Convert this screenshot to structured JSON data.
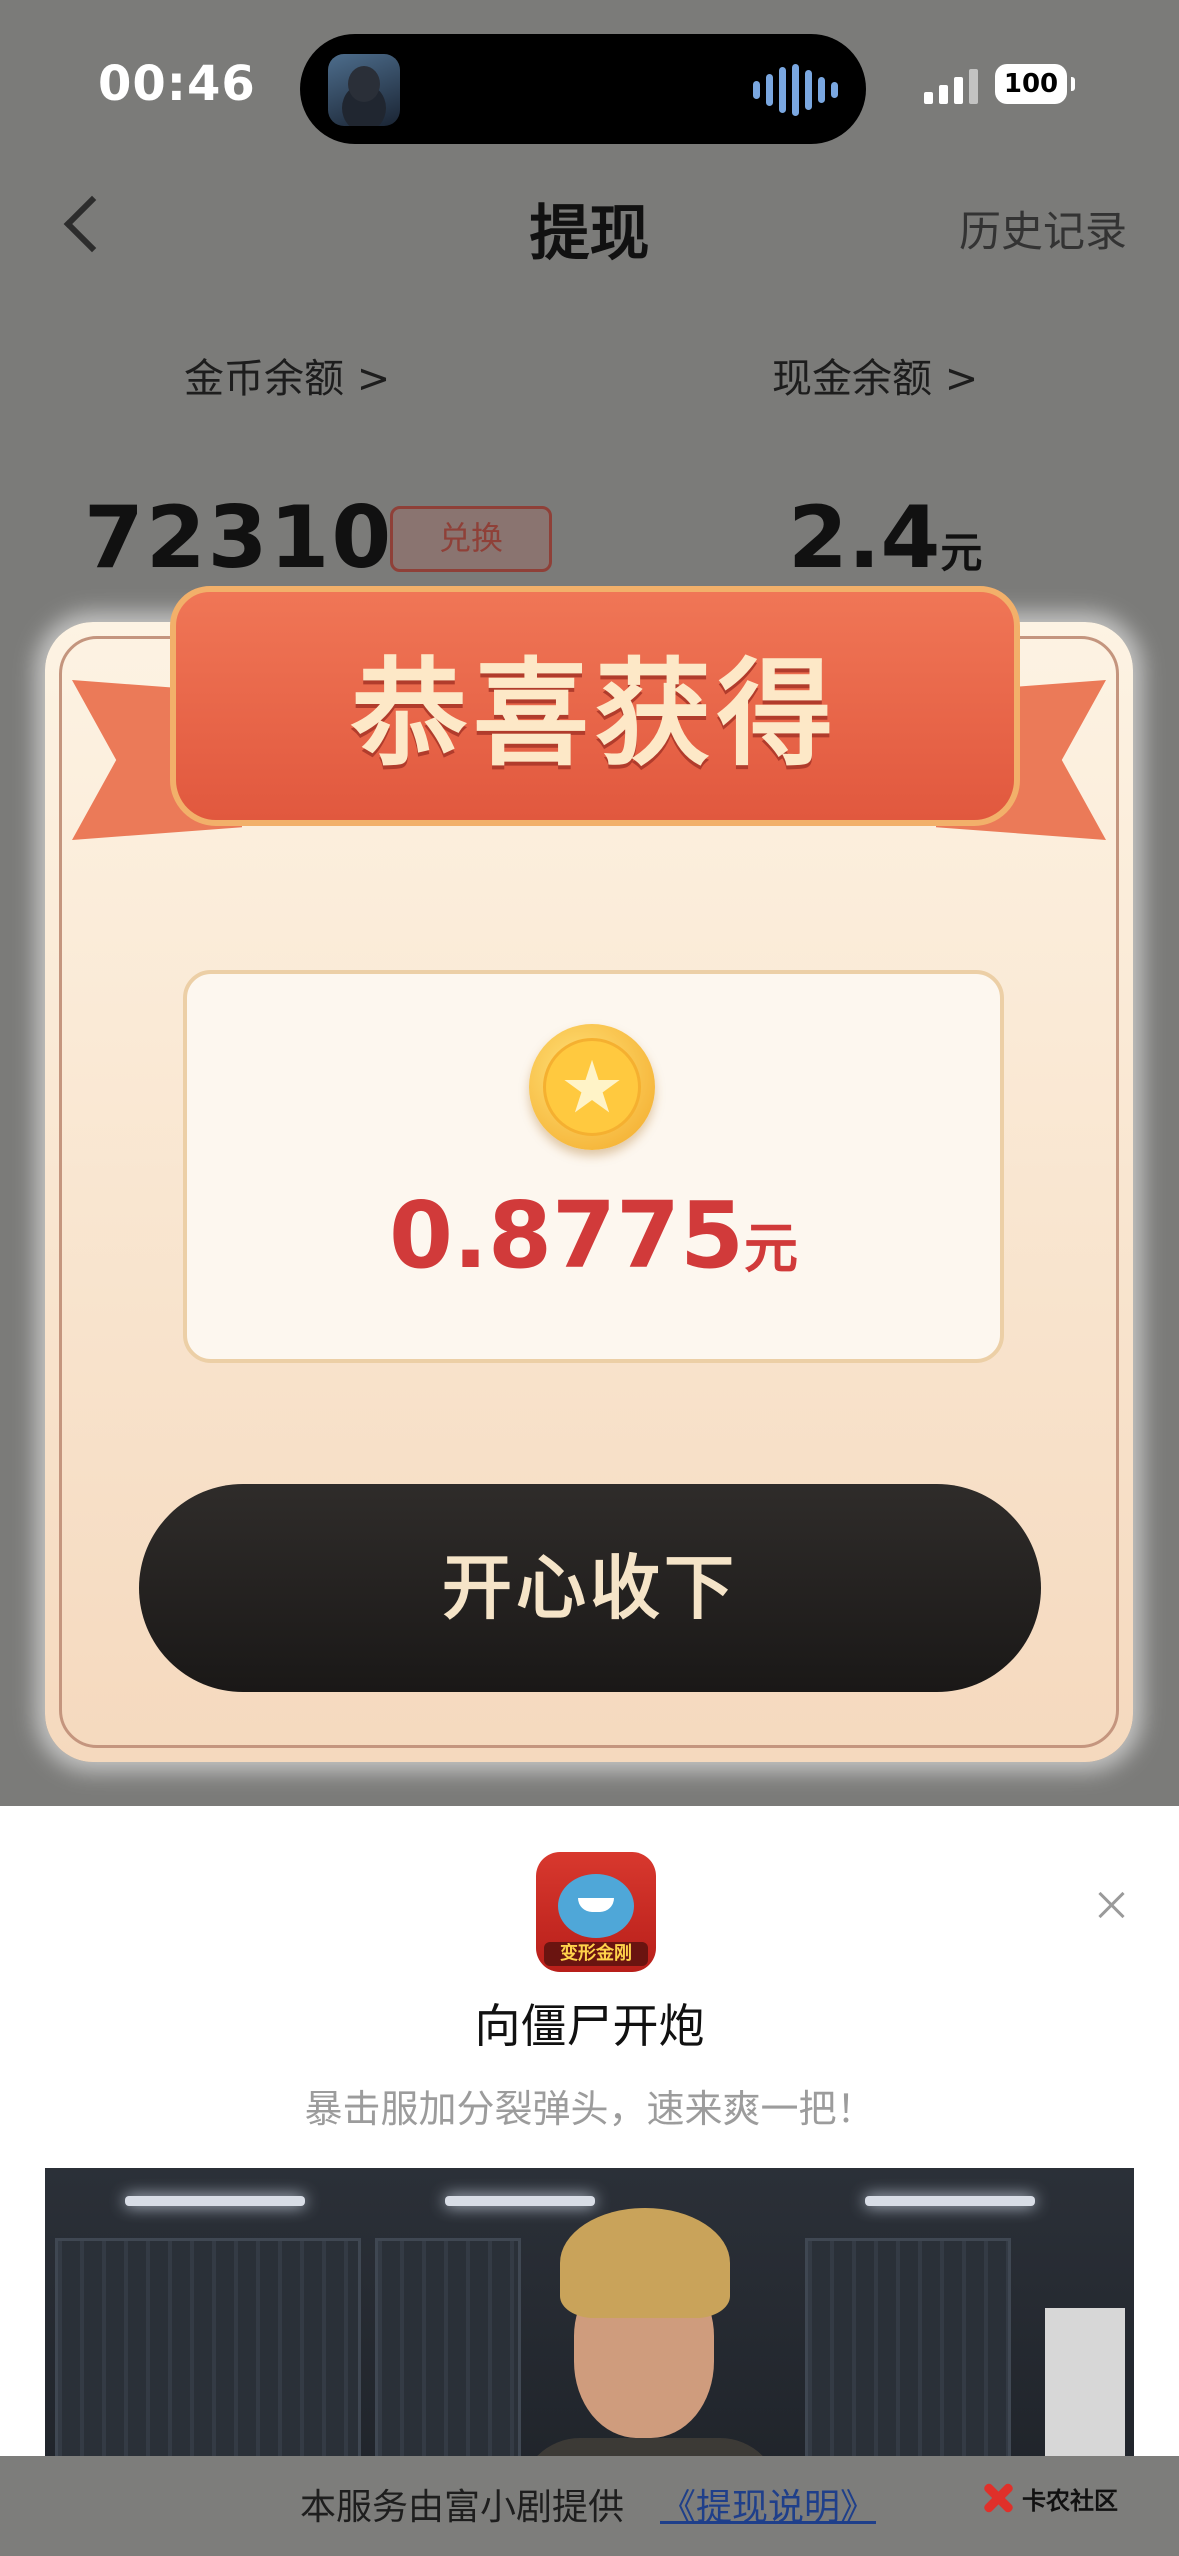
{
  "status_bar": {
    "time": "00:46",
    "battery": "100"
  },
  "nav": {
    "title": "提现",
    "history": "历史记录"
  },
  "balances": {
    "coin_label": "金币余额 >",
    "cash_label": "现金余额 >",
    "coin_amount": "72310",
    "exchange_label": "兑换",
    "cash_amount": "2.4",
    "cash_unit": "元"
  },
  "modal": {
    "title": "恭喜获得",
    "amount": "0.8775",
    "unit": "元",
    "confirm_label": "开心收下"
  },
  "ad": {
    "app_badge": "变形金刚",
    "title": "向僵尸开炮",
    "description": "暴击服加分裂弹头，速来爽一把！"
  },
  "footer": {
    "text": "本服务由富小剧提供",
    "link": "《提现说明》",
    "watermark": "卡农社区"
  }
}
